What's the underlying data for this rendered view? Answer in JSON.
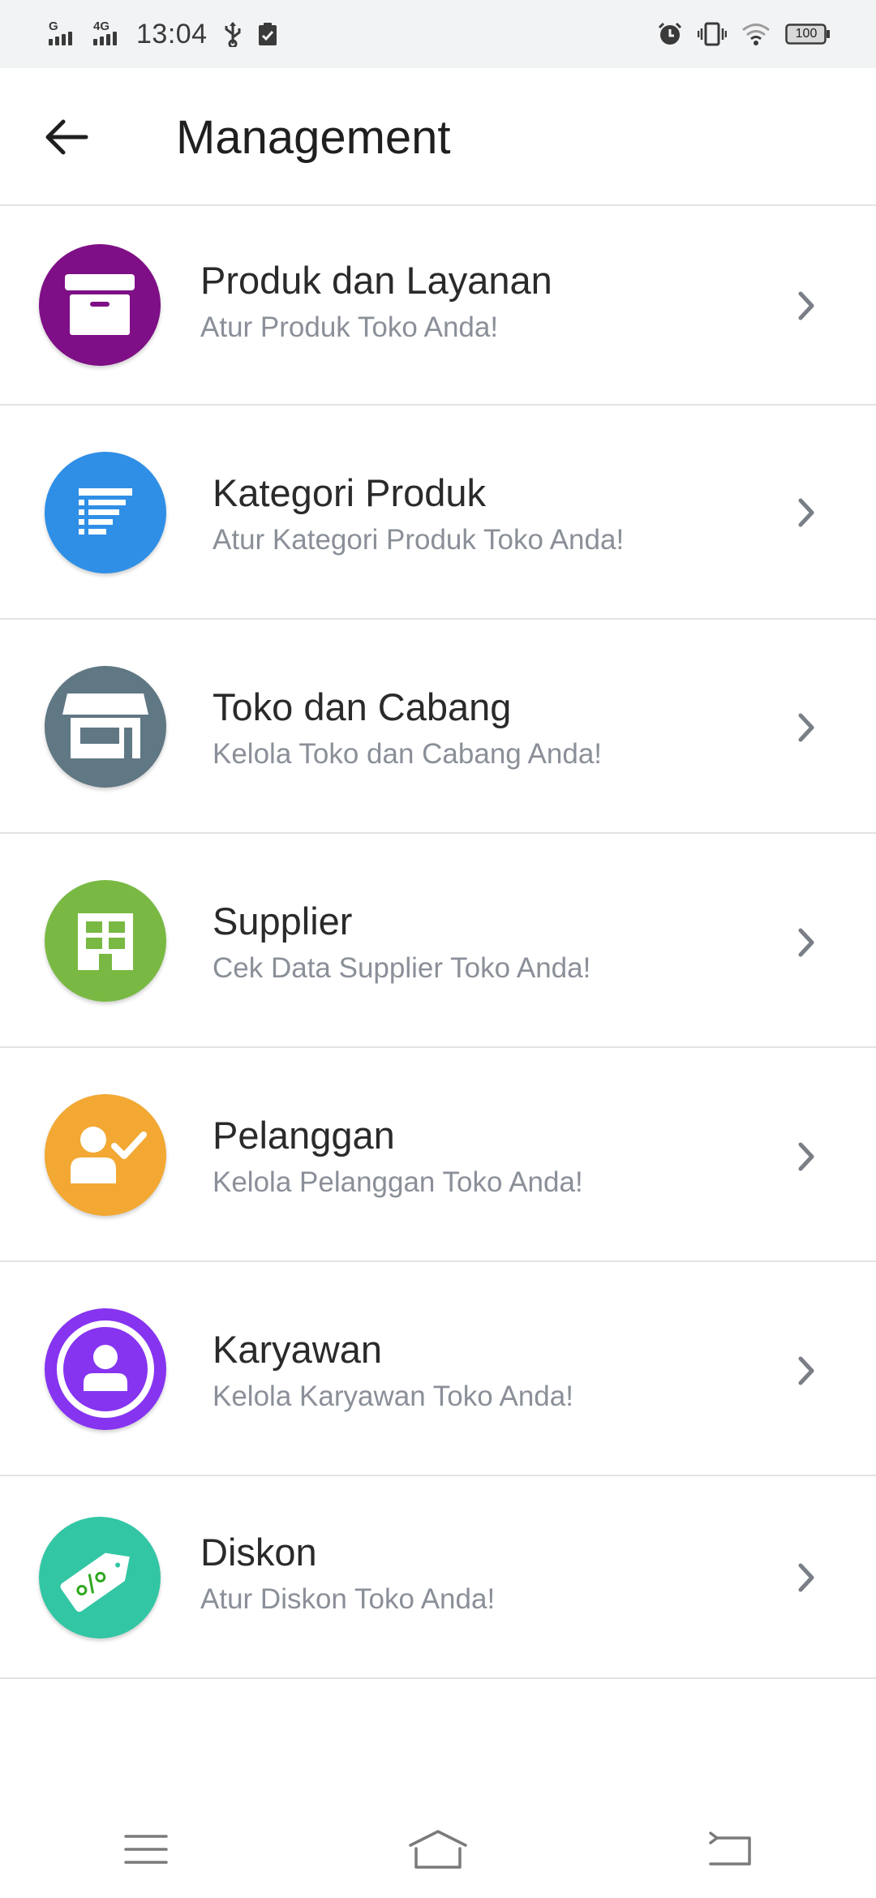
{
  "status_bar": {
    "network_1": "G",
    "network_2": "4G",
    "time": "13:04",
    "battery": "100"
  },
  "header": {
    "title": "Management",
    "back_icon": "arrow-left-icon"
  },
  "menu": [
    {
      "title": "Produk dan Layanan",
      "subtitle": "Atur Produk Toko Anda!",
      "icon": "archive-box-icon",
      "color": "#7e0f86"
    },
    {
      "title": "Kategori Produk",
      "subtitle": "Atur Kategori Produk Toko Anda!",
      "icon": "list-icon",
      "color": "#2f8fe6"
    },
    {
      "title": "Toko dan Cabang",
      "subtitle": "Kelola Toko dan Cabang Anda!",
      "icon": "store-icon",
      "color": "#607784"
    },
    {
      "title": "Supplier",
      "subtitle": "Cek Data Supplier Toko Anda!",
      "icon": "building-icon",
      "color": "#79b943"
    },
    {
      "title": "Pelanggan",
      "subtitle": "Kelola Pelanggan Toko Anda!",
      "icon": "user-check-icon",
      "color": "#f2a833"
    },
    {
      "title": "Karyawan",
      "subtitle": "Kelola Karyawan Toko Anda!",
      "icon": "employee-icon",
      "color": "#8634f0"
    },
    {
      "title": "Diskon",
      "subtitle": "Atur Diskon Toko Anda!",
      "icon": "discount-tag-icon",
      "color": "#33c6a4"
    }
  ],
  "nav": {
    "menu_icon": "hamburger-menu-icon",
    "home_icon": "home-icon",
    "back_icon": "back-icon"
  }
}
